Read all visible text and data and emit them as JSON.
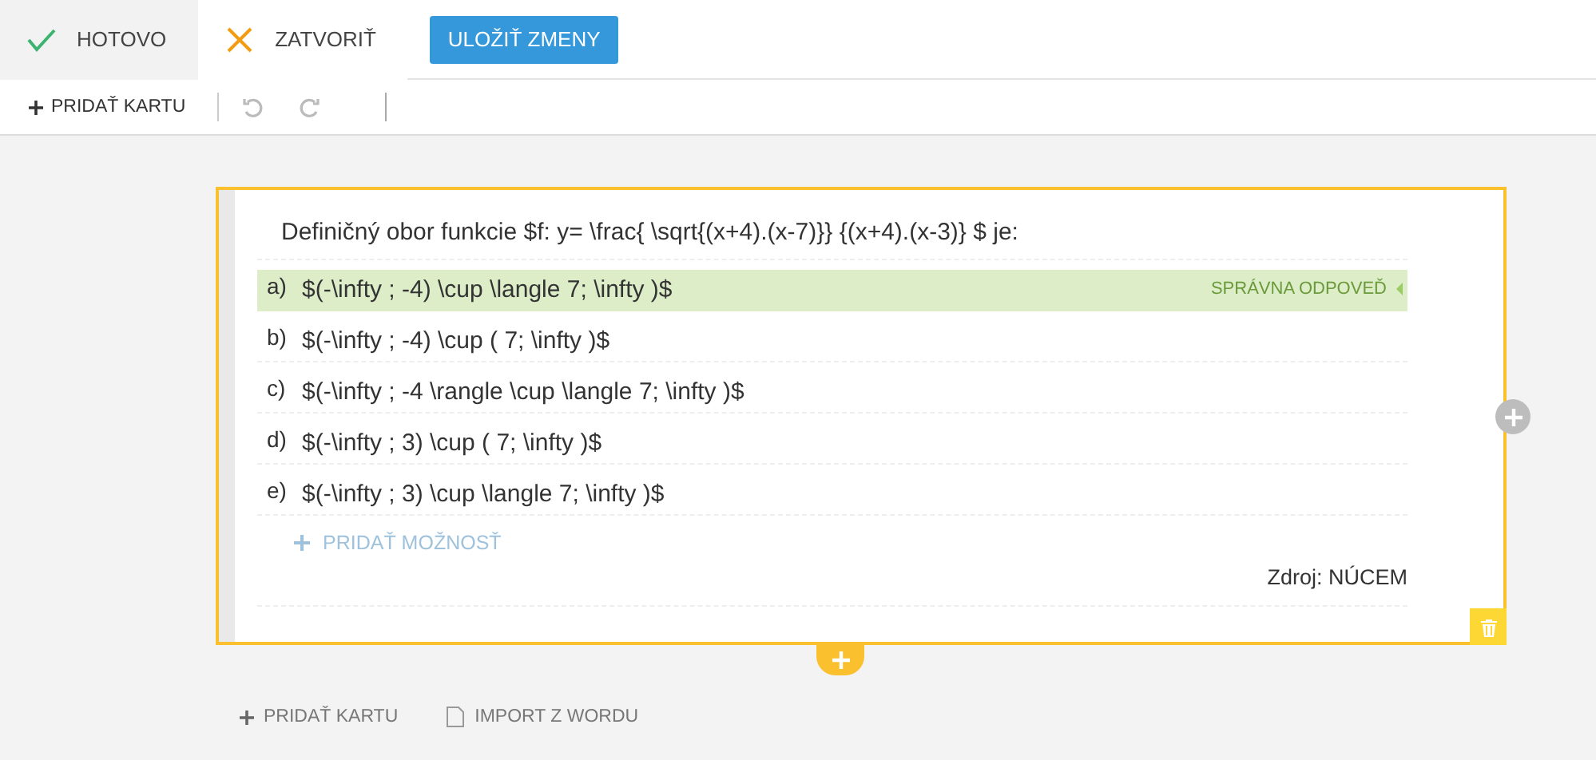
{
  "top_bar": {
    "done": {
      "label": "HOTOVO",
      "selected": true
    },
    "close": {
      "label": "ZATVORIŤ"
    },
    "save": {
      "label": "ULOŽIŤ ZMENY"
    }
  },
  "toolbar": {
    "add_card": "PRIDAŤ KARTU",
    "undo_disabled": true,
    "redo_disabled": true
  },
  "card": {
    "question": "Definičný obor funkcie $f: y= \\frac{ \\sqrt{(x+4).(x-7)}} {(x+4).(x-3)} $ je:",
    "correct_label": "SPRÁVNA ODPOVEĎ",
    "options": [
      {
        "letter": "a)",
        "text": "$(-\\infty ; -4) \\cup \\langle 7; \\infty )$",
        "correct": true
      },
      {
        "letter": "b)",
        "text": "$(-\\infty ; -4) \\cup ( 7; \\infty )$",
        "correct": false
      },
      {
        "letter": "c)",
        "text": "$(-\\infty ; -4 \\rangle \\cup \\langle 7; \\infty )$",
        "correct": false
      },
      {
        "letter": "d)",
        "text": "$(-\\infty ; 3) \\cup ( 7; \\infty )$",
        "correct": false
      },
      {
        "letter": "e)",
        "text": "$(-\\infty ; 3) \\cup \\langle 7; \\infty )$",
        "correct": false
      }
    ],
    "add_option": "PRIDAŤ MOŽNOSŤ",
    "source": "Zdroj: NÚCEM"
  },
  "bottom_links": {
    "add_card": "PRIDAŤ KARTU",
    "import": "IMPORT Z WORDU"
  }
}
